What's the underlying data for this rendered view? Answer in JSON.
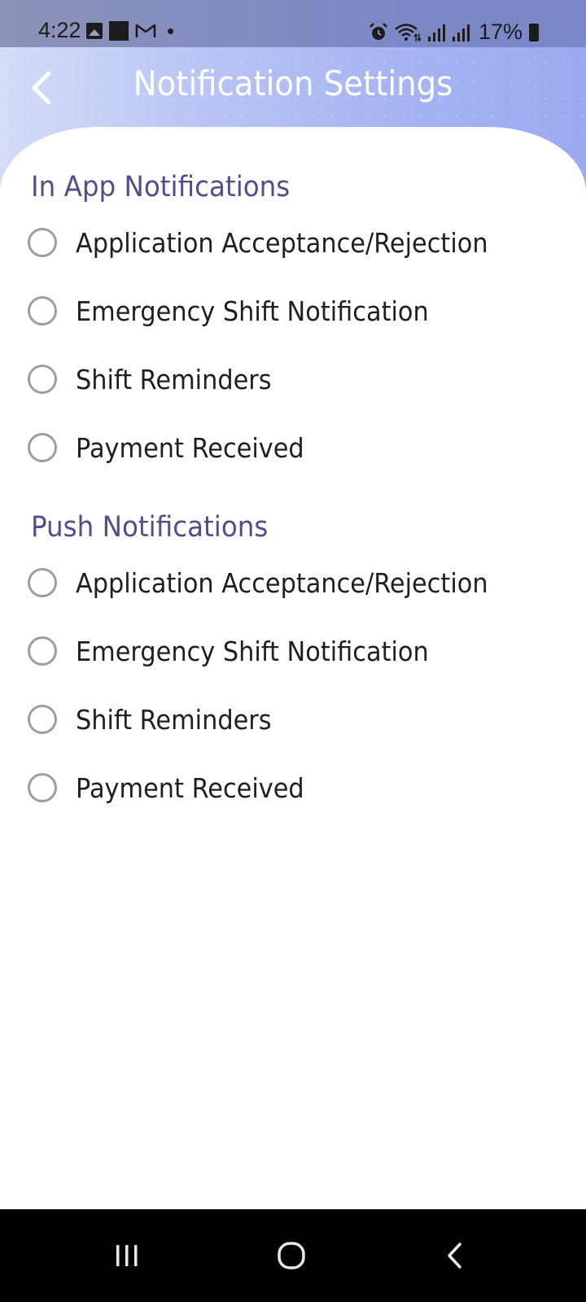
{
  "status_bar": {
    "time": "4:22",
    "battery": "17%",
    "icons": [
      "gallery-icon",
      "app-square-icon",
      "gmail-icon",
      "notification-dot-icon",
      "alarm-icon",
      "wifi-icon",
      "signal-icon",
      "signal-icon",
      "battery-icon"
    ]
  },
  "header": {
    "title": "Notification Settings",
    "back_icon": "chevron-left-icon"
  },
  "colors": {
    "section_title": "#5a4a8c",
    "option_text": "#1f1f1f",
    "radio_border": "#9e9e9e",
    "header_gradient_start": "#d5dcf8",
    "header_gradient_end": "#9aaaf0"
  },
  "sections": [
    {
      "title": "In App Notifications",
      "options": [
        {
          "label": "Application Acceptance/Rejection",
          "selected": false
        },
        {
          "label": "Emergency Shift Notification",
          "selected": false
        },
        {
          "label": "Shift Reminders",
          "selected": false
        },
        {
          "label": "Payment Received",
          "selected": false
        }
      ]
    },
    {
      "title": "Push Notifications",
      "options": [
        {
          "label": "Application Acceptance/Rejection",
          "selected": false
        },
        {
          "label": "Emergency Shift Notification",
          "selected": false
        },
        {
          "label": "Shift Reminders",
          "selected": false
        },
        {
          "label": "Payment Received",
          "selected": false
        }
      ]
    }
  ],
  "nav_bar": {
    "buttons": [
      "recent-apps-icon",
      "home-icon",
      "back-icon"
    ]
  }
}
